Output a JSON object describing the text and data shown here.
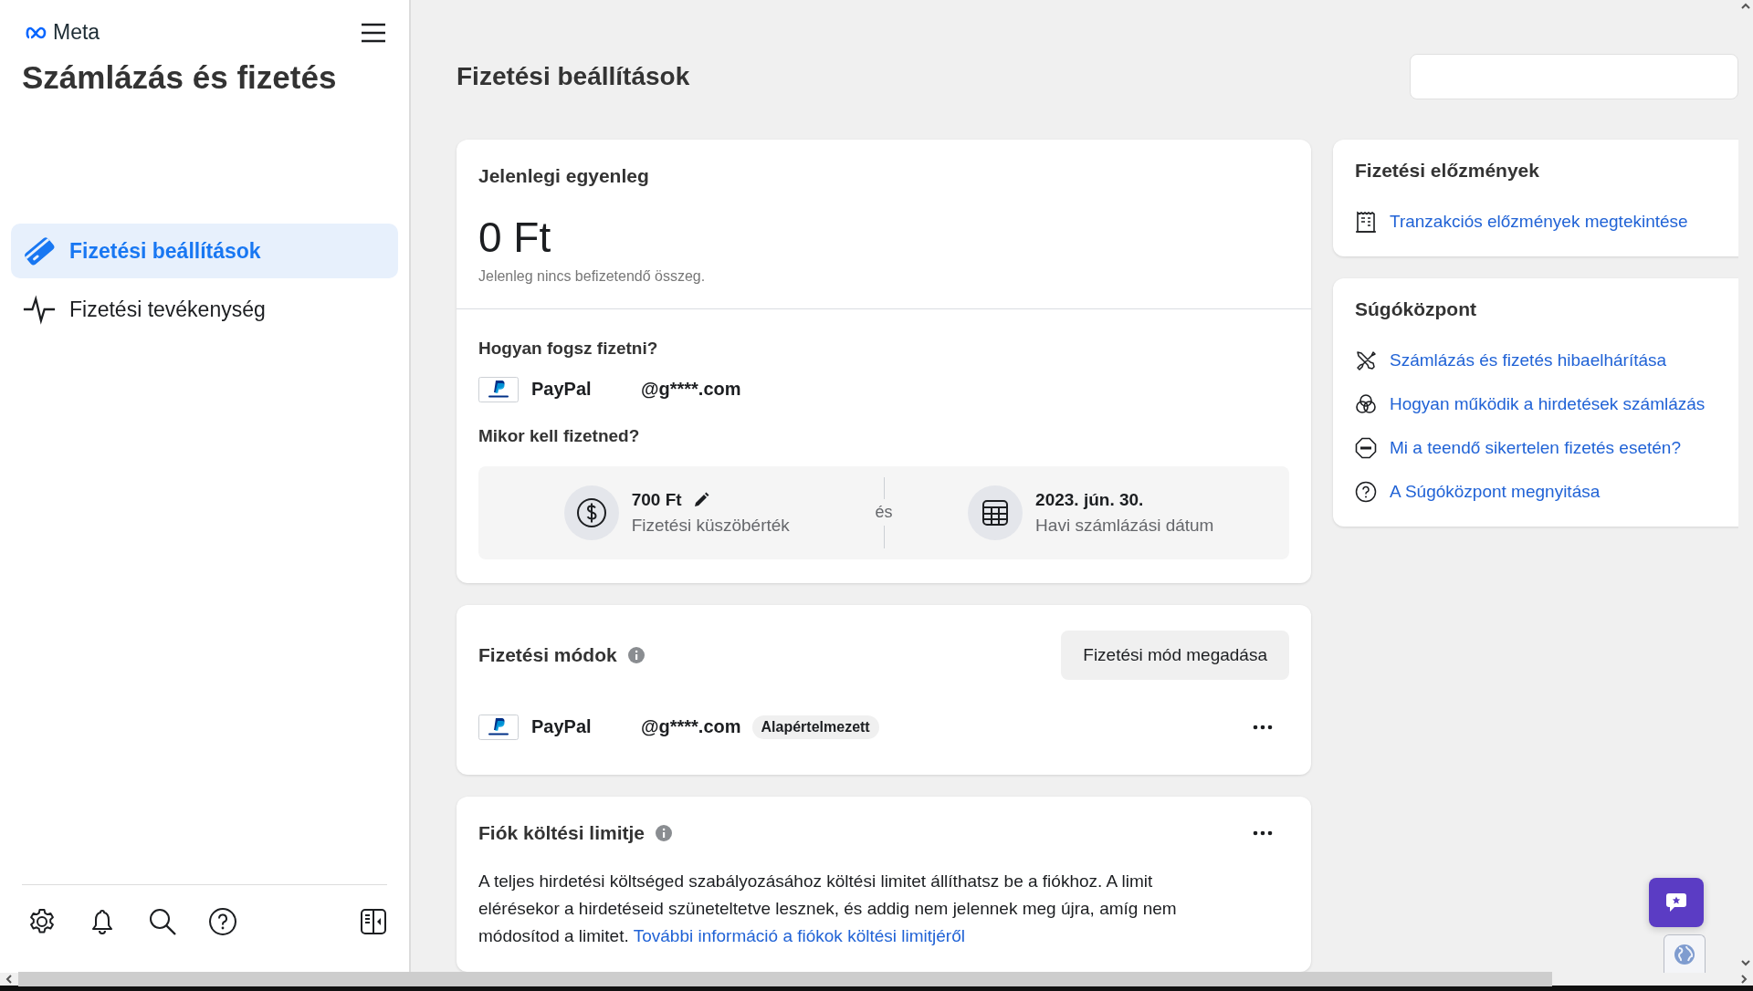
{
  "sidebar": {
    "brand": "Meta",
    "title": "Számlázás és fizetés",
    "nav": [
      {
        "label": "Fizetési beállítások",
        "selected": true
      },
      {
        "label": "Fizetési tevékenység",
        "selected": false
      }
    ]
  },
  "page_title": "Fizetési beállítások",
  "balance_card": {
    "title": "Jelenlegi egyenleg",
    "amount": "0 Ft",
    "note": "Jelenleg nincs befizetendő összeg.",
    "how_title": "Hogyan fogsz fizetni?",
    "method": {
      "name": "PayPal",
      "account": "@g****.com"
    },
    "when_title": "Mikor kell fizetned?",
    "threshold": {
      "value": "700 Ft",
      "label": "Fizetési küszöbérték"
    },
    "joiner": "és",
    "billing_date": {
      "value": "2023. jún. 30.",
      "label": "Havi számlázási dátum"
    }
  },
  "payment_methods": {
    "title": "Fizetési módok",
    "add_button": "Fizetési mód megadása",
    "methods": [
      {
        "name": "PayPal",
        "account": "@g****.com",
        "badge": "Alapértelmezett"
      }
    ]
  },
  "spending_limit": {
    "title": "Fiók költési limitje",
    "text": "A teljes hirdetési költséged szabályozásához költési limitet állíthatsz be a fiókhoz. A limit elérésekor a hirdetéseid szüneteltetve lesznek, és addig nem jelennek meg újra, amíg nem módosítod a limitet.",
    "link": "További információ a fiókok költési limitjéről"
  },
  "history": {
    "title": "Fizetési előzmények",
    "link": "Tranzakciós előzmények megtekintése"
  },
  "help": {
    "title": "Súgóközpont",
    "links": [
      {
        "label": "Számlázás és fizetés hibaelhárítása"
      },
      {
        "label": "Hogyan működik a hirdetések számlázás"
      },
      {
        "label": "Mi a teendő sikertelen fizetés esetén?"
      },
      {
        "label": "A Súgóközpont megnyitása"
      }
    ]
  }
}
